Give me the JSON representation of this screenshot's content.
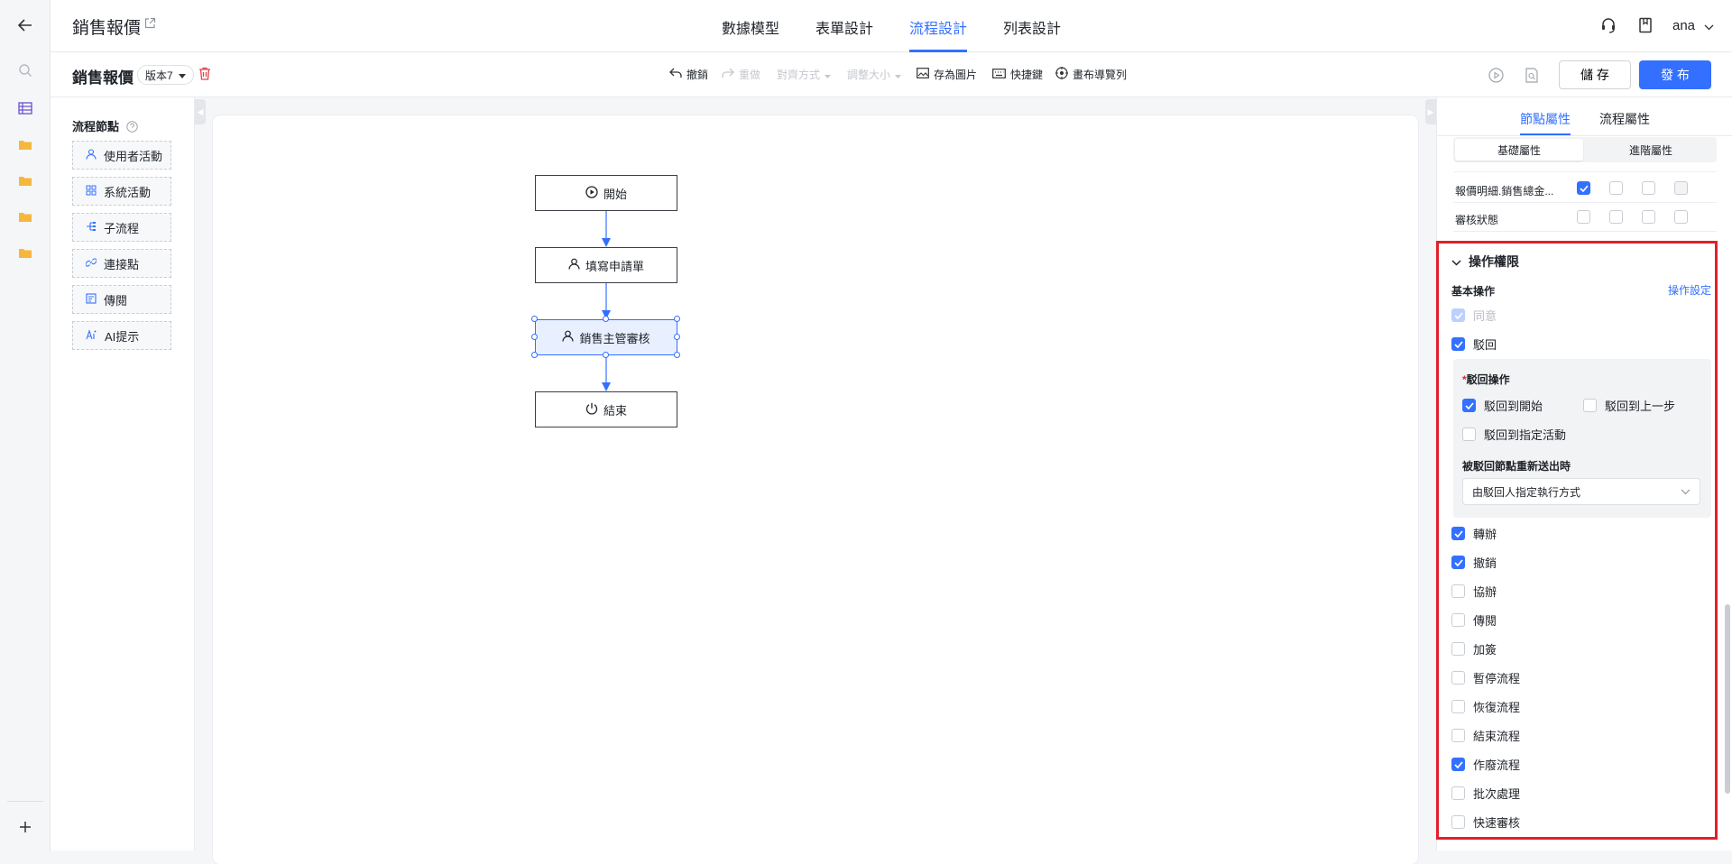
{
  "header": {
    "title": "銷售報價",
    "tabs": [
      {
        "label": "數據模型"
      },
      {
        "label": "表單設計"
      },
      {
        "label": "流程設計"
      },
      {
        "label": "列表設計"
      }
    ],
    "user": "ana"
  },
  "toolbar": {
    "title": "銷售報價",
    "version": "版本7",
    "undo": "撤銷",
    "redo": "重做",
    "align": "對齊方式",
    "resize": "調整大小",
    "save_image": "存為圖片",
    "shortcuts": "快捷鍵",
    "navigator": "畫布導覽列",
    "save": "儲 存",
    "publish": "發 布"
  },
  "nodes_panel": {
    "title": "流程節點",
    "items": [
      {
        "label": "使用者活動",
        "icon": "user-icon"
      },
      {
        "label": "系統活動",
        "icon": "grid-icon"
      },
      {
        "label": "子流程",
        "icon": "subflow-icon"
      },
      {
        "label": "連接點",
        "icon": "link-icon"
      },
      {
        "label": "傳閱",
        "icon": "document-icon"
      },
      {
        "label": "AI提示",
        "icon": "ai-icon"
      }
    ]
  },
  "flow": {
    "nodes": [
      {
        "label": "開始",
        "icon": "play-circle-icon"
      },
      {
        "label": "填寫申請單",
        "icon": "user-icon"
      },
      {
        "label": "銷售主管審核",
        "icon": "user-icon"
      },
      {
        "label": "結束",
        "icon": "power-icon"
      }
    ]
  },
  "props": {
    "tabs": [
      "節點屬性",
      "流程屬性"
    ],
    "segments": [
      "基礎屬性",
      "進階屬性"
    ],
    "field_rows": [
      {
        "label": "報價明細.銷售總金...",
        "checks": [
          true,
          false,
          false,
          false
        ]
      },
      {
        "label": "審核狀態",
        "checks": [
          false,
          false,
          false,
          false
        ]
      }
    ],
    "ops": {
      "title": "操作權限",
      "basic_label": "基本操作",
      "settings_link": "操作設定",
      "agree": "同意",
      "reject": "駁回",
      "reject_ops_label": "駁回操作",
      "reject_options": [
        {
          "label": "駁回到開始",
          "checked": true
        },
        {
          "label": "駁回到上一步",
          "checked": false
        },
        {
          "label": "駁回到指定活動",
          "checked": false
        }
      ],
      "resubmit_label": "被駁回節點重新送出時",
      "resubmit_value": "由駁回人指定執行方式",
      "items": [
        {
          "label": "轉辦",
          "checked": true
        },
        {
          "label": "撤銷",
          "checked": true
        },
        {
          "label": "協辦",
          "checked": false
        },
        {
          "label": "傳閱",
          "checked": false
        },
        {
          "label": "加簽",
          "checked": false
        },
        {
          "label": "暫停流程",
          "checked": false
        },
        {
          "label": "恢復流程",
          "checked": false
        },
        {
          "label": "結束流程",
          "checked": false
        },
        {
          "label": "作廢流程",
          "checked": true
        },
        {
          "label": "批次處理",
          "checked": false
        },
        {
          "label": "快速審核",
          "checked": false
        }
      ]
    }
  },
  "colors": {
    "accent": "#3370ff",
    "highlight": "#e0202a"
  }
}
